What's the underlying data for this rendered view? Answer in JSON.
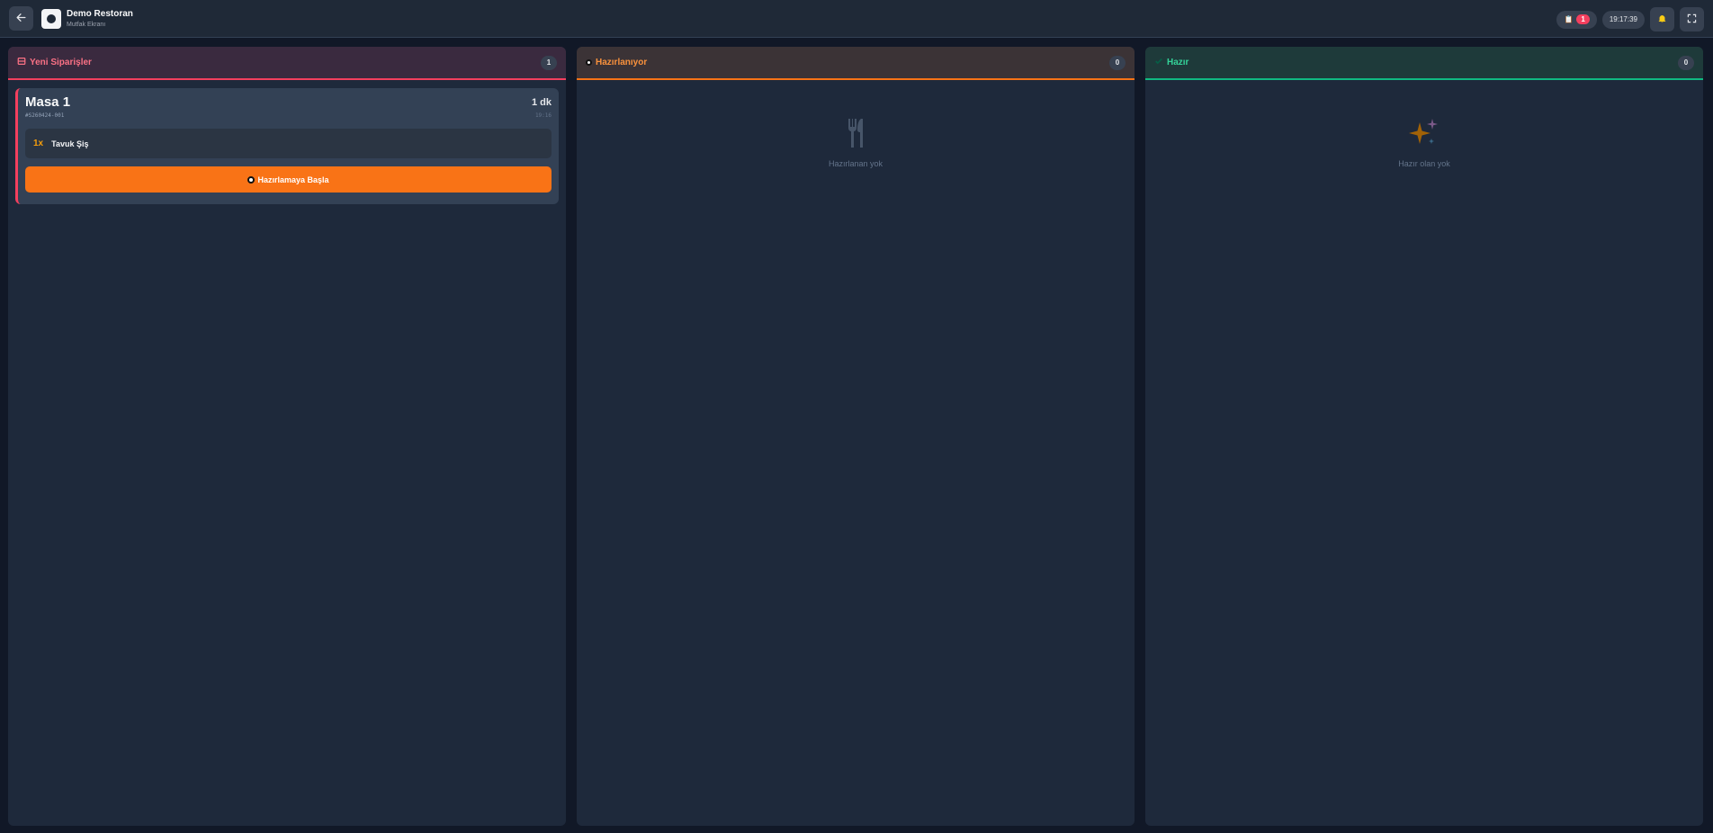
{
  "header": {
    "back_icon": "arrow-left-icon",
    "restaurant_name": "Demo Restoran",
    "screen_name": "Mutfak Ekranı",
    "order_count_badge": "1",
    "clock": "19:17:39"
  },
  "columns": [
    {
      "title": "Yeni Siparişler",
      "count": "1",
      "accent": "#f43f5e",
      "header_bg": "#3a2a3f",
      "icon": "inbox-icon"
    },
    {
      "title": "Hazırlanıyor",
      "count": "0",
      "accent": "#f97316",
      "header_bg": "#3b3336",
      "icon": "fire-icon",
      "empty_text": "Hazırlanan yok"
    },
    {
      "title": "Hazır",
      "count": "0",
      "accent": "#10b981",
      "header_bg": "#1e3a3a",
      "icon": "check-icon",
      "empty_text": "Hazır olan yok"
    }
  ],
  "orders": [
    {
      "table": "Masa 1",
      "order_no": "#S260424-001",
      "elapsed": "1 dk",
      "time": "19:16",
      "items": [
        {
          "qty": "1x",
          "name": "Tavuk Şiş"
        }
      ],
      "action_label": "Hazırlamaya Başla"
    }
  ]
}
